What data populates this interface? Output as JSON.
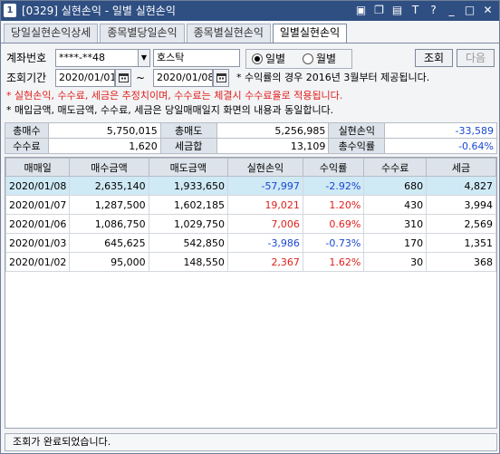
{
  "window": {
    "icon_text": "1",
    "title": "[0329] 실현손익 - 일별 실현손익",
    "controls": [
      "▣",
      "❐",
      "▤",
      "T",
      "?",
      "_",
      "□",
      "✕"
    ]
  },
  "tabs": [
    {
      "label": "당일실현손익상세",
      "active": false
    },
    {
      "label": "종목별당일손익",
      "active": false
    },
    {
      "label": "종목별실현손익",
      "active": false
    },
    {
      "label": "일별실현손익",
      "active": true
    }
  ],
  "form": {
    "account_label": "계좌번호",
    "account_value": "****-**48",
    "account_name": "호스탁",
    "period_label": "조회기간",
    "date_from": "2020/01/01",
    "tilde": "~",
    "date_to": "2020/01/08",
    "radio_daily": "일별",
    "radio_monthly": "월별",
    "radio_selected": "daily",
    "query_button": "조회",
    "next_button": "다음",
    "notice": "* 수익률의 경우 2016년 3월부터 제공됩니다."
  },
  "notes": {
    "red": "* 실현손익, 수수료, 세금은 추정치이며, 수수료는 체결시 수수료율로 적용됩니다.",
    "black": "* 매입금액, 매도금액, 수수료, 세금은 당일매매일지 화면의 내용과 동일합니다."
  },
  "summary": {
    "total_buy_label": "총매수",
    "total_buy": "5,750,015",
    "total_sell_label": "총매도",
    "total_sell": "5,256,985",
    "realized_label": "실현손익",
    "realized": "-33,589",
    "fee_label": "수수료",
    "fee": "1,620",
    "tax_label": "세금합",
    "tax": "13,109",
    "total_return_label": "총수익률",
    "total_return": "-0.64%"
  },
  "colors": {
    "negative": "#1a47d4",
    "positive": "#e0201c",
    "selected_row": "#cfe9f5"
  },
  "table": {
    "headers": [
      "매매일",
      "매수금액",
      "매도금액",
      "실현손익",
      "수익률",
      "수수료",
      "세금"
    ],
    "rows": [
      {
        "date": "2020/01/08",
        "buy": "2,635,140",
        "sell": "1,933,650",
        "pnl": "-57,997",
        "rate": "-2.92%",
        "fee": "680",
        "tax": "4,827",
        "sign": "neg",
        "selected": true
      },
      {
        "date": "2020/01/07",
        "buy": "1,287,500",
        "sell": "1,602,185",
        "pnl": "19,021",
        "rate": "1.20%",
        "fee": "430",
        "tax": "3,994",
        "sign": "pos",
        "selected": false
      },
      {
        "date": "2020/01/06",
        "buy": "1,086,750",
        "sell": "1,029,750",
        "pnl": "7,006",
        "rate": "0.69%",
        "fee": "310",
        "tax": "2,569",
        "sign": "pos",
        "selected": false
      },
      {
        "date": "2020/01/03",
        "buy": "645,625",
        "sell": "542,850",
        "pnl": "-3,986",
        "rate": "-0.73%",
        "fee": "170",
        "tax": "1,351",
        "sign": "neg",
        "selected": false
      },
      {
        "date": "2020/01/02",
        "buy": "95,000",
        "sell": "148,550",
        "pnl": "2,367",
        "rate": "1.62%",
        "fee": "30",
        "tax": "368",
        "sign": "pos",
        "selected": false
      }
    ]
  },
  "status": "조회가 완료되었습니다."
}
